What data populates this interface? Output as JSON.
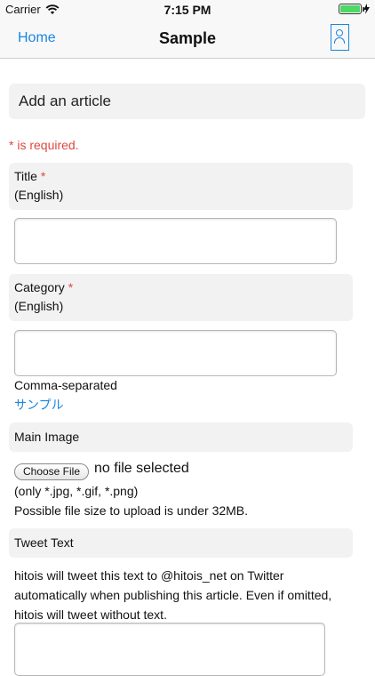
{
  "status_bar": {
    "carrier": "Carrier",
    "time": "7:15 PM"
  },
  "nav": {
    "back_label": "Home",
    "title": "Sample"
  },
  "form": {
    "heading": "Add an article",
    "required_note": "* is required.",
    "title_field": {
      "label": "Title",
      "required_mark": "*",
      "sub_label": "(English)",
      "value": ""
    },
    "category_field": {
      "label": "Category",
      "required_mark": "*",
      "sub_label": "(English)",
      "value": "",
      "hint": "Comma-separated",
      "sample_link": "サンプル"
    },
    "main_image": {
      "label": "Main Image",
      "button_label": "Choose File",
      "status": "no file selected",
      "formats": "(only *.jpg, *.gif, *.png)",
      "size_note": "Possible file size to upload is under 32MB."
    },
    "tweet_text": {
      "label": "Tweet Text",
      "description": "hitois will tweet this text to @hitois_net on Twitter automatically when publishing this article. Even if omitted, hitois will tweet without text.",
      "value": ""
    }
  },
  "colors": {
    "accent": "#1a86e0",
    "required": "#e0473d",
    "battery": "#4cd964"
  }
}
